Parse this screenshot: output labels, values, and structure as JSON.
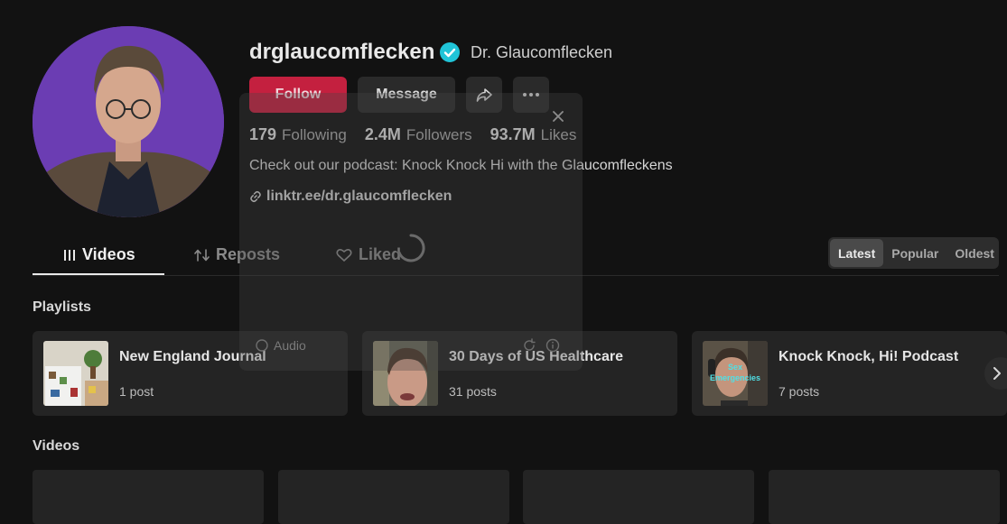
{
  "profile": {
    "username": "drglaucomflecken",
    "display_name": "Dr. Glaucomflecken",
    "bio": "Check out our podcast: Knock Knock Hi with the Glaucomfleckens",
    "link": "linktr.ee/dr.glaucomflecken"
  },
  "actions": {
    "follow": "Follow",
    "message": "Message"
  },
  "stats": {
    "following_count": "179",
    "following_label": "Following",
    "followers_count": "2.4M",
    "followers_label": "Followers",
    "likes_count": "93.7M",
    "likes_label": "Likes"
  },
  "tabs": {
    "videos": "Videos",
    "reposts": "Reposts",
    "liked": "Liked"
  },
  "sort": {
    "options": [
      "Latest",
      "Popular",
      "Oldest"
    ],
    "selected": "Latest"
  },
  "sections": {
    "playlists": "Playlists",
    "videos": "Videos"
  },
  "playlists": [
    {
      "name": "New England Journal",
      "count": "1 post"
    },
    {
      "name": "30 Days of US Healthcare",
      "count": "31 posts"
    },
    {
      "name": "Knock Knock, Hi! Podcast",
      "count": "7 posts",
      "thumb_text": "Sex Emergencies"
    }
  ],
  "overlay": {
    "audio_label": "Audio"
  },
  "colors": {
    "background": "#121212",
    "follow": "#c4203f",
    "verified": "#20c4d8"
  }
}
